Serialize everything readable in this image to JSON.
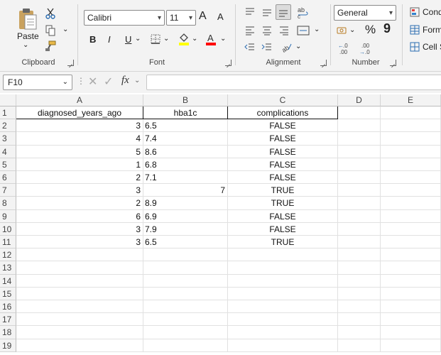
{
  "ribbon": {
    "clipboard": {
      "paste": "Paste",
      "label": "Clipboard"
    },
    "font": {
      "name": "Calibri",
      "size": "11",
      "bold": "B",
      "italic": "I",
      "underline": "U",
      "grow": "A",
      "shrink": "A",
      "label": "Font",
      "highlight_color": "#ffff00",
      "font_color": "#ff0000"
    },
    "alignment": {
      "label": "Alignment"
    },
    "number": {
      "format": "General",
      "label": "Number",
      "percent": "%",
      "comma": "9",
      "inc_dec": ".0→.00",
      "dec_dec": ".00→.0"
    },
    "styles": {
      "conditional": "Cond",
      "format_table": "Form",
      "cell_styles": "Cell S"
    }
  },
  "formula_bar": {
    "name_box": "F10",
    "fx": "fx",
    "formula": ""
  },
  "sheet": {
    "columns": [
      "A",
      "B",
      "C",
      "D",
      "E"
    ],
    "rows": [
      "1",
      "2",
      "3",
      "4",
      "5",
      "6",
      "7",
      "8",
      "9",
      "10",
      "11",
      "12",
      "13",
      "14",
      "15",
      "16",
      "17",
      "18",
      "19"
    ],
    "cells": [
      [
        "diagnosed_years_ago",
        "hba1c",
        "complications"
      ],
      [
        "3",
        "6.5",
        "FALSE"
      ],
      [
        "4",
        "7.4",
        "FALSE"
      ],
      [
        "5",
        "8.6",
        "FALSE"
      ],
      [
        "1",
        "6.8",
        "FALSE"
      ],
      [
        "2",
        "7.1",
        "FALSE"
      ],
      [
        "3",
        "7",
        "TRUE"
      ],
      [
        "2",
        "8.9",
        "TRUE"
      ],
      [
        "6",
        "6.9",
        "FALSE"
      ],
      [
        "3",
        "7.9",
        "FALSE"
      ],
      [
        "3",
        "6.5",
        "TRUE"
      ]
    ]
  }
}
